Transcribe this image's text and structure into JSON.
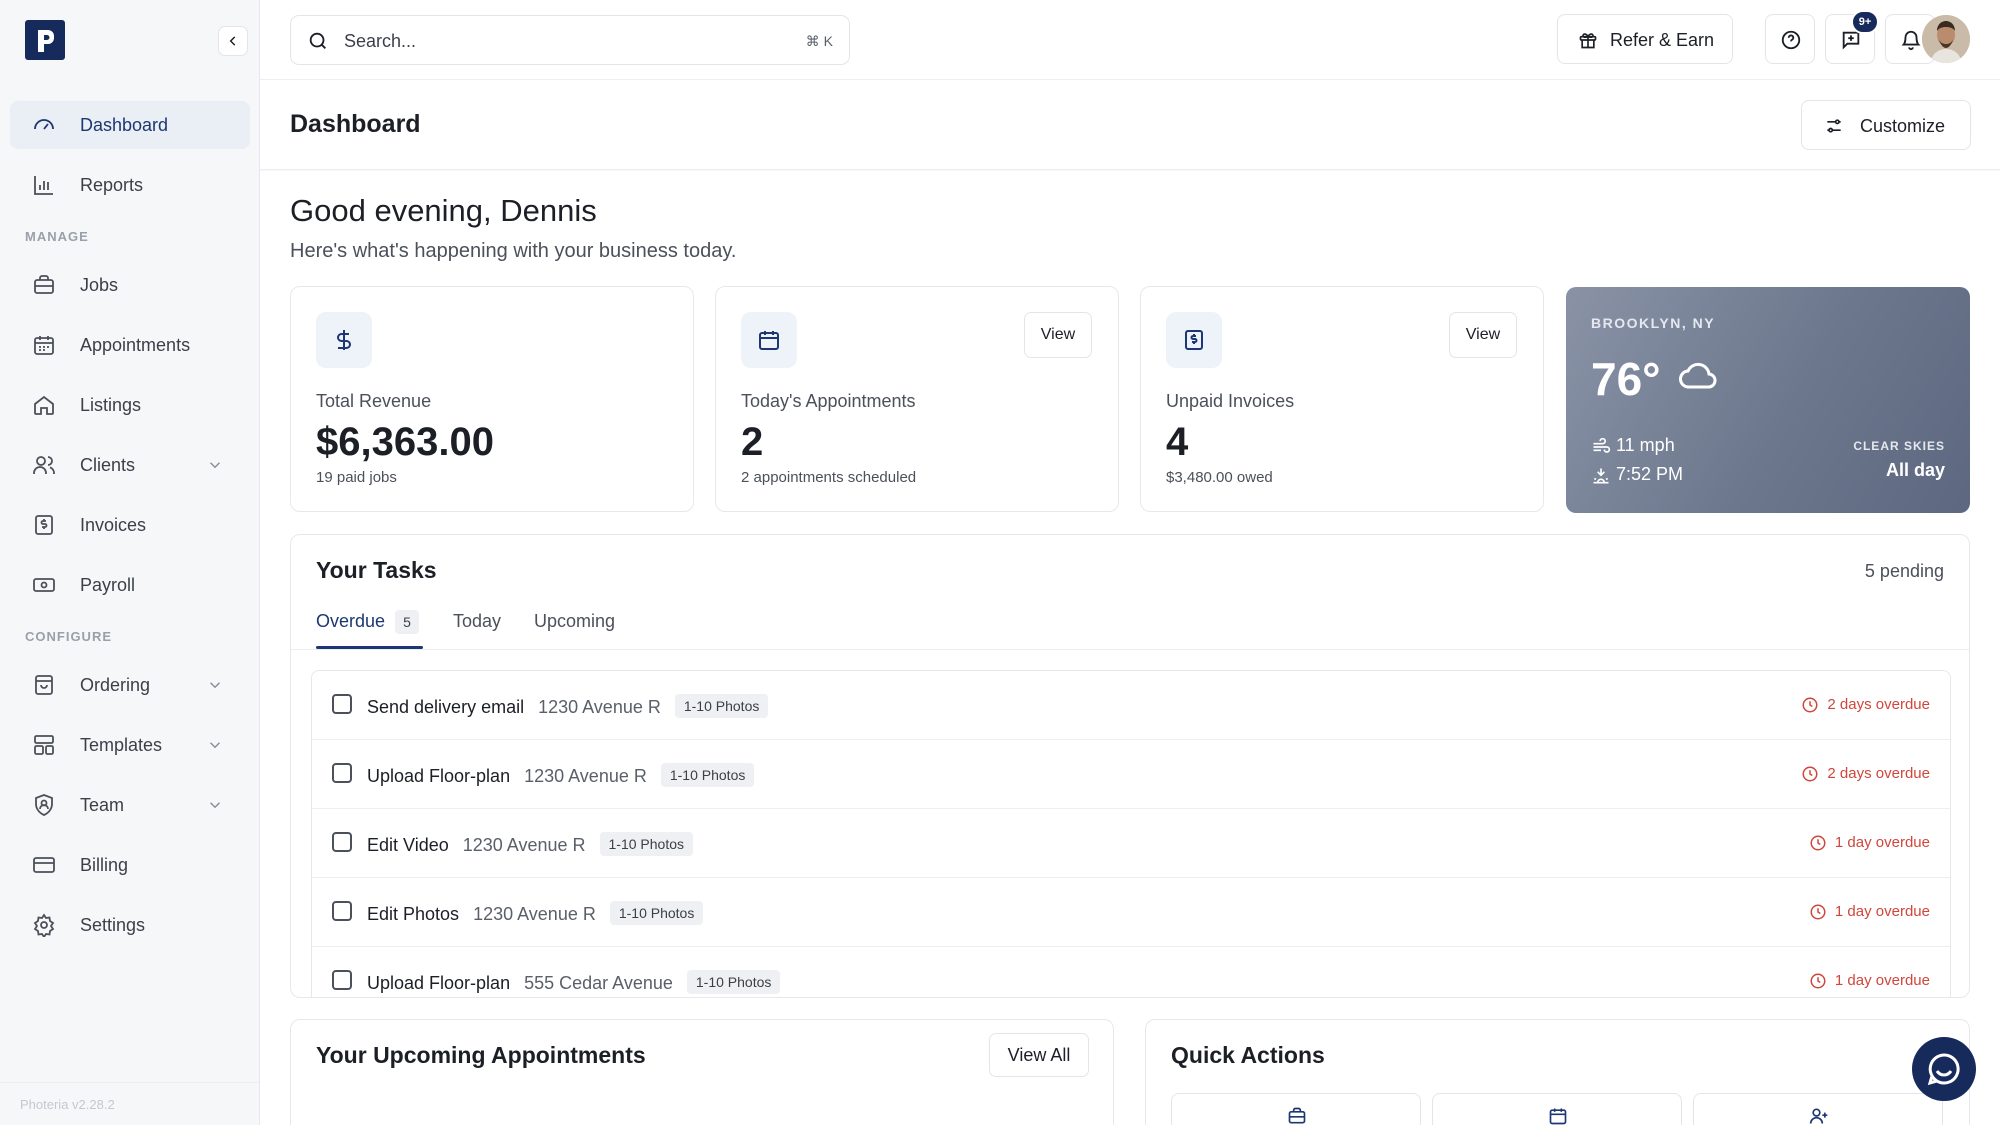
{
  "sidebar": {
    "logo_letter": "p",
    "version": "Photeria v2.28.2",
    "section_manage": "MANAGE",
    "section_configure": "CONFIGURE",
    "items": [
      {
        "label": "Dashboard",
        "icon": "gauge-icon"
      },
      {
        "label": "Reports",
        "icon": "bar-chart-icon"
      },
      {
        "label": "Jobs",
        "icon": "briefcase-icon"
      },
      {
        "label": "Appointments",
        "icon": "calendar-icon"
      },
      {
        "label": "Listings",
        "icon": "home-icon"
      },
      {
        "label": "Clients",
        "icon": "users-icon"
      },
      {
        "label": "Invoices",
        "icon": "invoice-icon"
      },
      {
        "label": "Payroll",
        "icon": "banknote-icon"
      },
      {
        "label": "Ordering",
        "icon": "shopping-bag-icon"
      },
      {
        "label": "Templates",
        "icon": "layout-icon"
      },
      {
        "label": "Team",
        "icon": "shield-user-icon"
      },
      {
        "label": "Billing",
        "icon": "credit-card-icon"
      },
      {
        "label": "Settings",
        "icon": "gear-icon"
      }
    ]
  },
  "topbar": {
    "search_placeholder": "Search...",
    "search_shortcut": "⌘ K",
    "refer_label": "Refer & Earn",
    "notification_badge": "9+"
  },
  "header": {
    "title": "Dashboard",
    "customize_label": "Customize"
  },
  "greeting": {
    "title": "Good evening, Dennis",
    "subtitle": "Here's what's happening with your business today."
  },
  "stats": [
    {
      "label": "Total Revenue",
      "value": "$6,363.00",
      "sub": "19 paid jobs",
      "icon": "dollar-icon"
    },
    {
      "label": "Today's Appointments",
      "value": "2",
      "sub": "2 appointments scheduled",
      "icon": "calendar-icon",
      "button": "View"
    },
    {
      "label": "Unpaid Invoices",
      "value": "4",
      "sub": "$3,480.00 owed",
      "icon": "invoice-icon",
      "button": "View"
    }
  ],
  "weather": {
    "location": "BROOKLYN, NY",
    "temp": "76°",
    "wind": "11 mph",
    "sunset": "7:52 PM",
    "condition_label": "CLEAR SKIES",
    "condition_value": "All day"
  },
  "tasks": {
    "title": "Your Tasks",
    "pending": "5 pending",
    "tabs": [
      {
        "label": "Overdue",
        "count": "5"
      },
      {
        "label": "Today"
      },
      {
        "label": "Upcoming"
      }
    ],
    "rows": [
      {
        "name": "Send delivery email",
        "address": "1230 Avenue R",
        "chip": "1-10 Photos",
        "due": "2 days overdue"
      },
      {
        "name": "Upload Floor-plan",
        "address": "1230 Avenue R",
        "chip": "1-10 Photos",
        "due": "2 days overdue"
      },
      {
        "name": "Edit Video",
        "address": "1230 Avenue R",
        "chip": "1-10 Photos",
        "due": "1 day overdue"
      },
      {
        "name": "Edit Photos",
        "address": "1230 Avenue R",
        "chip": "1-10 Photos",
        "due": "1 day overdue"
      },
      {
        "name": "Upload Floor-plan",
        "address": "555 Cedar Avenue",
        "chip": "1-10 Photos",
        "due": "1 day overdue"
      }
    ]
  },
  "appointments": {
    "title": "Your Upcoming Appointments",
    "view_all": "View All"
  },
  "quick_actions": {
    "title": "Quick Actions"
  },
  "colors": {
    "brand": "#162a5c",
    "accent": "#1c3772",
    "overdue": "#d0463b"
  }
}
